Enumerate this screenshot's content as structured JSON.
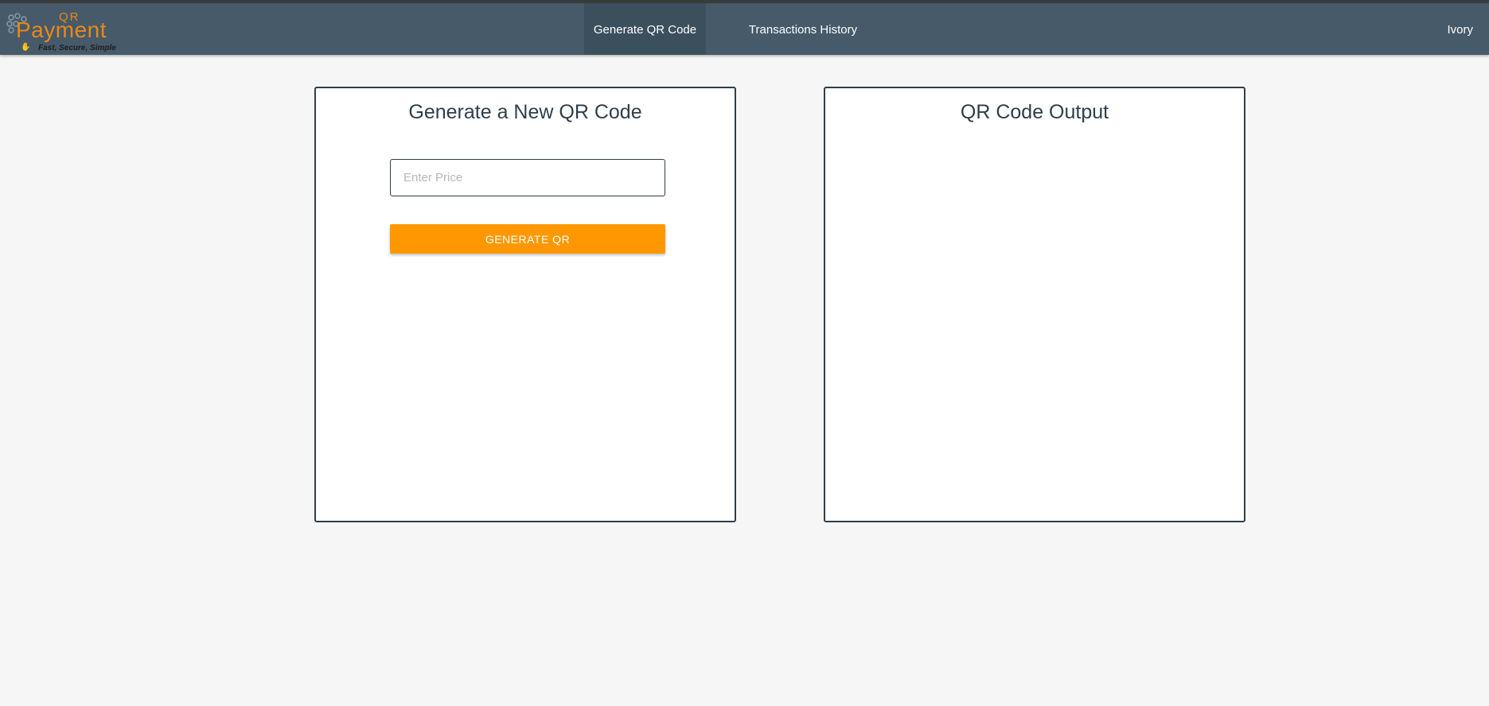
{
  "brand": {
    "logo_small": "QR",
    "logo_main": "Payment",
    "tagline": "Fast, Secure, Simple",
    "accent_color": "#e8891a"
  },
  "nav": {
    "items": [
      {
        "label": "Generate QR Code",
        "active": true
      },
      {
        "label": "Transactions History",
        "active": false
      }
    ],
    "user": "Ivory"
  },
  "generator": {
    "title": "Generate a New QR Code",
    "price_placeholder": "Enter Price",
    "price_value": "",
    "button_label": "GENERATE QR",
    "button_color": "#ff9800"
  },
  "output": {
    "title": "QR Code Output"
  }
}
